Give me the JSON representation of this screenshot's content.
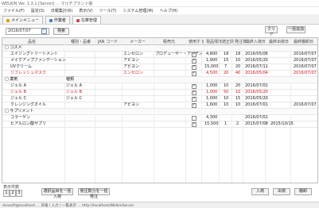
{
  "window": {
    "title": "WELKIN Ver. 1.3.1 [Server] ... マルチプラント版"
  },
  "menu": [
    "ファイル(F)",
    "設定(S)",
    "日報集計(R)",
    "表示(V)",
    "ツール(T)",
    "システム管理(M)",
    "ヘルプ(H)"
  ],
  "tabs": [
    {
      "label": "メインメニュー",
      "color": "#d9a000"
    },
    {
      "label": "作業者",
      "color": "#4a7cc0"
    },
    {
      "label": "在庫管理",
      "color": "#c04a4a"
    }
  ],
  "filter": {
    "date_value": "2016/07/07",
    "search_label": "検索",
    "clear_label": "クリア",
    "add_label": "一括追加"
  },
  "grid": {
    "columns": [
      "品名",
      "種別・品番",
      "JAN コード",
      "メーカー",
      "販売元",
      "使用する",
      "現品残数",
      "適正数",
      "発注数",
      "最終入荷日",
      "最終出荷日",
      "最終棚卸日"
    ],
    "rows": [
      {
        "kind": "group",
        "name": "□ コスメ"
      },
      {
        "name": "エイジングトリートメント",
        "maker": "エンセロン",
        "seller": "プロデューサー・アジアン",
        "use": true,
        "stock": "4,800",
        "optimal": "18",
        "order": "18",
        "in": "2016/05/06",
        "last": "2016/07/07"
      },
      {
        "name": "メイクアップファンデーション",
        "maker": "アビヨン",
        "use": true,
        "stock": "1,900",
        "optimal": "15",
        "order": "10",
        "in": "2016/05/20",
        "last": "2016/07/07"
      },
      {
        "name": "UVクリーム",
        "maker": "アビヨン",
        "use": true,
        "stock": "15,000",
        "optimal": "7",
        "order": "20",
        "in": "2016/07/11",
        "last": "2016/07/07"
      },
      {
        "name": "リフレッシュマスク",
        "maker": "エンセロン",
        "use": true,
        "stock": "4,500",
        "optimal": "20",
        "order": "40",
        "in": "2016/05/04",
        "last": "2016/07/07",
        "red": true
      },
      {
        "kind": "group",
        "name": "□ 薬剤",
        "kind_label": "種類"
      },
      {
        "name": "ジェル A",
        "kind_label": "ジェル A",
        "use": true,
        "stock": "1,000",
        "optimal": "10",
        "order": "20",
        "in": "2016/07/01"
      },
      {
        "name": "ジェル B",
        "kind_label": "ジェル B",
        "use": true,
        "stock": "1,000",
        "optimal": "50",
        "order": "10",
        "in": "2016/05/20",
        "red": true
      },
      {
        "name": "ジェル C",
        "kind_label": "ジェル C",
        "use": true,
        "stock": "1,000",
        "optimal": "10",
        "order": "15",
        "in": "2016/05/20"
      },
      {
        "name": "クレンジングオイル",
        "maker": "アビヨン",
        "use": true,
        "stock": "1,600",
        "optimal": "10",
        "order": "10",
        "in": "2016/07/01",
        "last": "2016/07/07"
      },
      {
        "kind": "group",
        "name": "□ サプリメント"
      },
      {
        "name": "コラーゲン",
        "use": false,
        "stock": "4,300",
        "optimal": "",
        "order": "",
        "in": "2016/07/01"
      },
      {
        "name": "ヒアルロン酸サプリ",
        "use": true,
        "stock": "15,500",
        "optimal": "1",
        "order": "2",
        "in": "2015/07/08",
        "last": "2015/10/15"
      }
    ]
  },
  "pager": {
    "label": "表示件数",
    "pages": [
      "1",
      "2",
      "3"
    ],
    "btn_move_all": "選択品目を一括入荷",
    "btn_order_all": "発注数分を一括発注"
  },
  "footer_buttons": [
    "入荷",
    "出荷",
    "棚卸"
  ],
  "status": {
    "text": "dcosoft@localhost ... 日報 / 入力 / 一覧表示 ... http://localhost/WelkinServer"
  }
}
